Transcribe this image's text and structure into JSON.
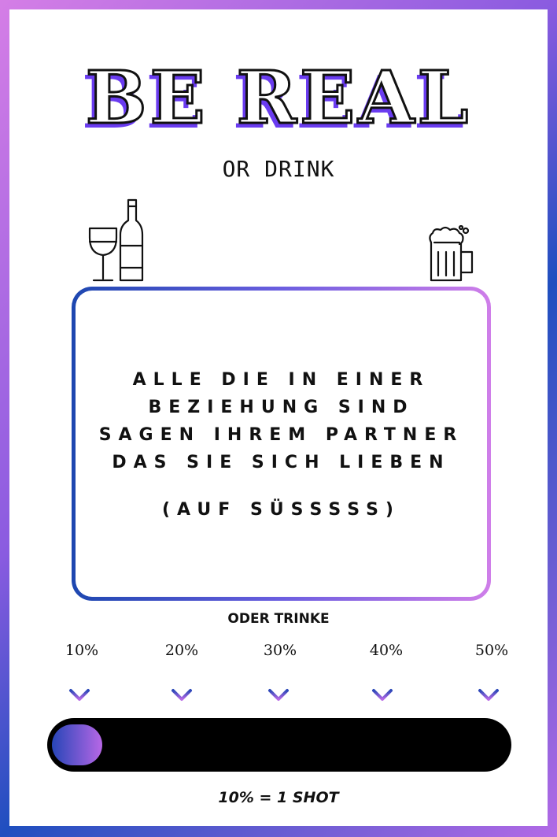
{
  "header": {
    "title": "BE REAL",
    "subtitle": "OR DRINK"
  },
  "icons": {
    "left": "wine-glass-and-bottle-icon",
    "right": "beer-mug-icon"
  },
  "card": {
    "text": "ALLE DIE IN EINER BEZIEHUNG SIND SAGEN IHREM PARTNER DAS SIE SICH LIEBEN",
    "note": "(AUF SÜSSSSS)"
  },
  "drink": {
    "label": "ODER TRINKE",
    "levels": [
      "10%",
      "20%",
      "30%",
      "40%",
      "50%"
    ],
    "progress_percent": 10,
    "footer": "10% = 1 SHOT"
  },
  "colors": {
    "accent_blue": "#1d47b0",
    "accent_purple": "#6a3cf0",
    "accent_pink": "#cf7ee9"
  }
}
